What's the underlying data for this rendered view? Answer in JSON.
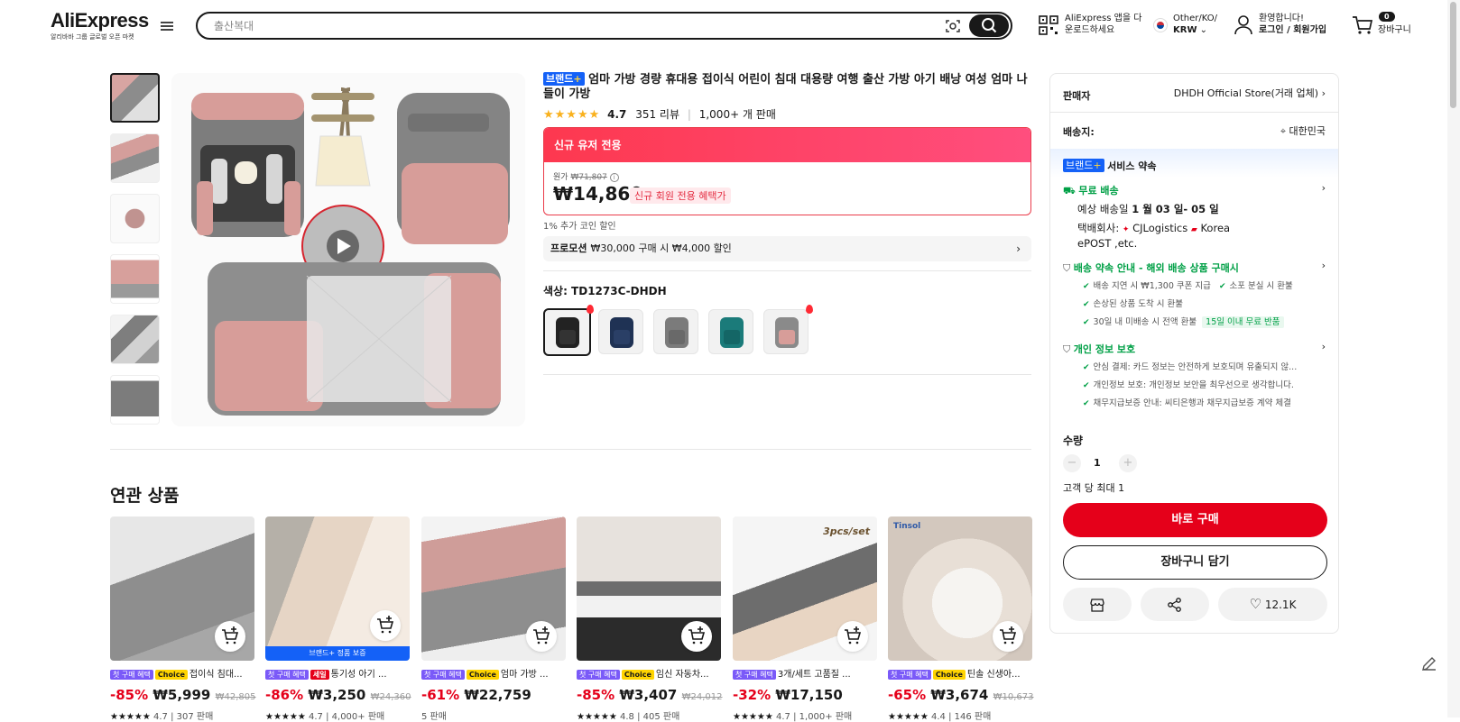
{
  "header": {
    "logo_text": "AliExpress",
    "logo_subtitle": "알리바바 그룹 글로벌 오픈 마켓",
    "search_placeholder": "출산복대",
    "app_download_line1": "AliExpress 앱을 다",
    "app_download_line2": "운로드하세요",
    "region_line1": "Other/KO/",
    "currency": "KRW",
    "welcome": "환영합니다!",
    "login_signup": "로그인 / 회원가입",
    "cart_count": "0",
    "cart_label": "장바구니"
  },
  "product": {
    "brand_tag": "브랜드",
    "brand_plus": "+",
    "title": "엄마 가방 경량 휴대용 접이식 어린이 침대 대용량 여행 출산 가방 아기 배낭 여성 엄마 나들이 가방",
    "rating": "4.7",
    "reviews": "351 리뷰",
    "sold": "1,000+ 개 판매",
    "new_user_bar": "신규 유저 전용",
    "original_label": "원가",
    "original_price": "₩71,807",
    "price": "₩14,860",
    "new_member_badge": "신규 회원 전용 혜택가",
    "coin_discount": "1% 추가 코인 할인",
    "promo_label": "프로모션",
    "promo_text": "₩30,000 구매 시 ₩4,000 할인",
    "color_label": "색상: TD1273C-DHDH"
  },
  "seller": {
    "seller_label": "판매자",
    "seller_name": "DHDH Official Store(거래 업체)",
    "ship_to_label": "배송지:",
    "ship_to_value": "대한민국",
    "service_brand": "브랜드",
    "service_plus": "+",
    "service_label": "서비스 약속",
    "free_ship": "무료 배송",
    "eta_prefix": "예상 배송일",
    "eta_value": "1 월 03 일- 05 일",
    "carrier_prefix": "택배회사:",
    "carrier1": "CJLogistics",
    "carrier2": "Korea",
    "carrier3": "ePOST ,etc.",
    "promise_title": "배송 약속 안내 - 해외 배송 상품 구매시",
    "promise_1": "배송 지연 시 ₩1,300 쿠폰 지급",
    "promise_2": "소포 분실 시 환불",
    "promise_3": "손상된 상품 도착 시 환불",
    "promise_4": "30일 내 미배송 시 전액 환불",
    "promise_badge": "15일 이내 무료 반품",
    "privacy_title": "개인 정보 보호",
    "privacy_1": "안심 결제: 카드 정보는 안전하게 보호되며 유출되지 않...",
    "privacy_2": "개인정보 보호: 개인정보 보안을 최우선으로 생각합니다.",
    "privacy_3": "채무지급보증 안내: 씨티은행과 채무지급보증 계약 체결",
    "qty_label": "수량",
    "qty_minus": "−",
    "qty_value": "1",
    "qty_plus": "+",
    "limit": "고객 당 최대 1",
    "buy_now": "바로 구매",
    "add_cart": "장바구니 담기",
    "wishlist_count": "12.1K"
  },
  "related": {
    "title": "연관 상품",
    "items": [
      {
        "first": "첫 구매 혜택",
        "badge": "Choice",
        "name": "접이식 침대...",
        "disc": "-85%",
        "price": "₩5,999",
        "orig": "₩42,805",
        "rating": "4.7",
        "sold": "307 판매"
      },
      {
        "first": "첫 구매 혜택",
        "badge": "세일",
        "name": "통기성 아기 ...",
        "disc": "-86%",
        "price": "₩3,250",
        "orig": "₩24,360",
        "rating": "4.7",
        "sold": "4,000+ 판매",
        "banner": "브랜드+ 정품 보증"
      },
      {
        "first": "첫 구매 혜택",
        "badge": "Choice",
        "name": "엄마 가방 ...",
        "disc": "-61%",
        "price": "₩22,759",
        "orig": "",
        "rating": "",
        "sold": "5 판매"
      },
      {
        "first": "첫 구매 혜택",
        "badge": "Choice",
        "name": "임신 자동차...",
        "disc": "-85%",
        "price": "₩3,407",
        "orig": "₩24,012",
        "rating": "4.8",
        "sold": "405 판매"
      },
      {
        "first": "첫 구매 혜택",
        "badge": "",
        "name": "3개/세트 고품질 ...",
        "disc": "-32%",
        "price": "₩17,150",
        "orig": "",
        "rating": "4.7",
        "sold": "1,000+ 판매"
      },
      {
        "first": "첫 구매 혜택",
        "badge": "Choice",
        "name": "틴솔 신생아...",
        "disc": "-65%",
        "price": "₩3,674",
        "orig": "₩10,673",
        "rating": "4.4",
        "sold": "146 판매"
      }
    ]
  },
  "image_text": {
    "card5": "3pcs/set",
    "card6": "Tinsol"
  },
  "colors": {
    "accent_red": "#e5001a",
    "brand_blue": "#1461f7",
    "green": "#00a046",
    "star": "#f9b11d"
  }
}
